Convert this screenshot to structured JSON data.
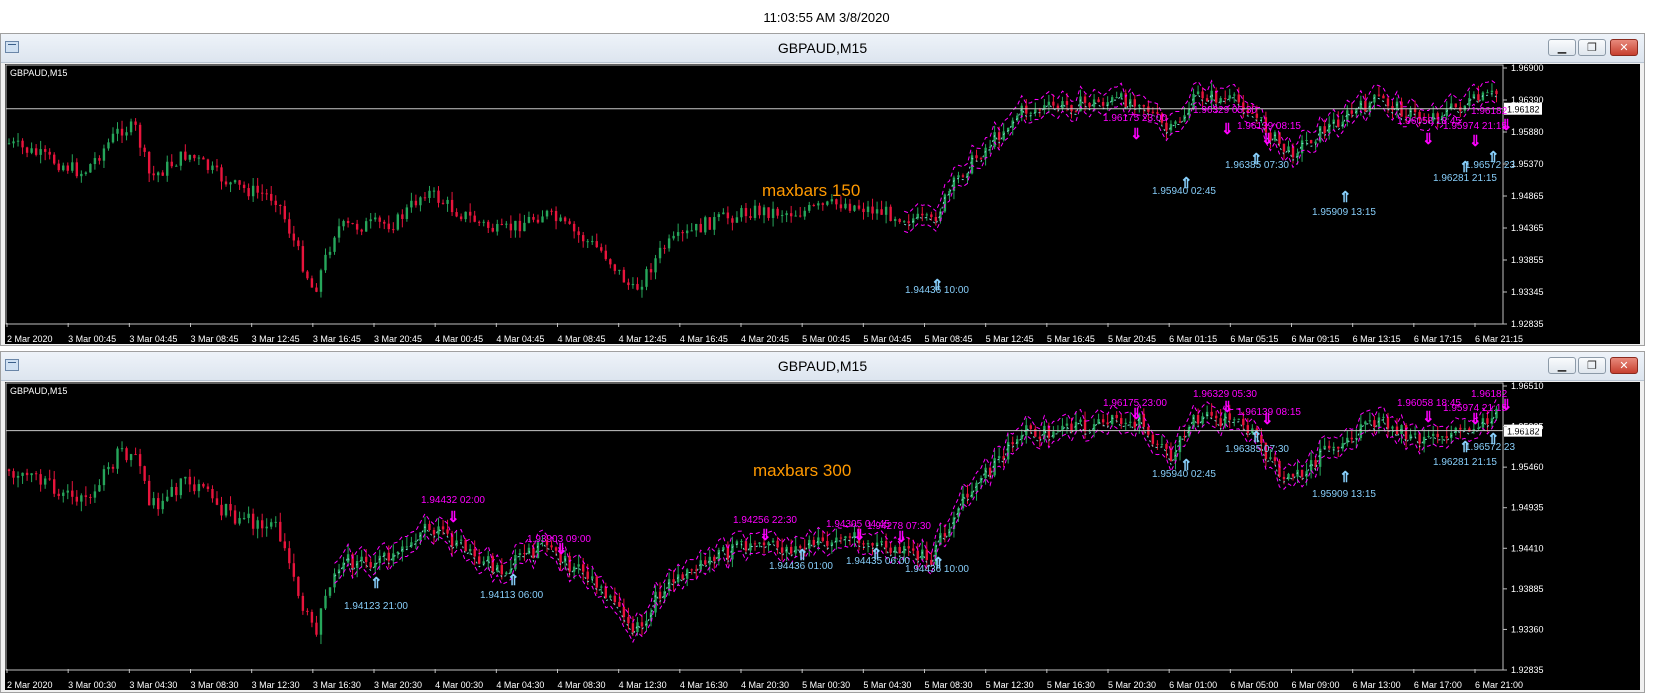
{
  "timestamp": "11:03:55 AM 3/8/2020",
  "windows": [
    {
      "title": "GBPAUD,M15",
      "symbol_label": "GBPAUD,M15",
      "annotation": "maxbars 150",
      "current_price": "1.96182",
      "price_axis": [
        "1.96900",
        "1.96390",
        "1.95880",
        "1.95370",
        "1.94865",
        "1.94365",
        "1.93855",
        "1.93345",
        "1.92835"
      ],
      "time_axis": [
        "2 Mar 2020",
        "3 Mar 00:45",
        "3 Mar 04:45",
        "3 Mar 08:45",
        "3 Mar 12:45",
        "3 Mar 16:45",
        "3 Mar 20:45",
        "4 Mar 00:45",
        "4 Mar 04:45",
        "4 Mar 08:45",
        "4 Mar 12:45",
        "4 Mar 16:45",
        "4 Mar 20:45",
        "5 Mar 00:45",
        "5 Mar 04:45",
        "5 Mar 08:45",
        "5 Mar 12:45",
        "5 Mar 16:45",
        "5 Mar 20:45",
        "6 Mar 01:15",
        "6 Mar 05:15",
        "6 Mar 09:15",
        "6 Mar 13:15",
        "6 Mar 17:15",
        "6 Mar 21:15"
      ],
      "high_labels": [
        "1.96175 23:00",
        "1.96329 05:30",
        "1.96139 08:15",
        "1.96058 18:45",
        "1.95974 21:15",
        "1.96182"
      ],
      "low_labels": [
        "1.94436 10:00",
        "1.95940 02:45",
        "1.96385 07:30",
        "1.95909 13:15",
        "1.96281 21:15",
        "1.96572 23"
      ]
    },
    {
      "title": "GBPAUD,M15",
      "symbol_label": "GBPAUD,M15",
      "annotation": "maxbars 300",
      "current_price": "1.96182",
      "price_axis": [
        "1.96510",
        "1.95985",
        "1.95460",
        "1.94935",
        "1.94410",
        "1.93885",
        "1.93360",
        "1.92835"
      ],
      "time_axis": [
        "2 Mar 2020",
        "3 Mar 00:30",
        "3 Mar 04:30",
        "3 Mar 08:30",
        "3 Mar 12:30",
        "3 Mar 16:30",
        "3 Mar 20:30",
        "4 Mar 00:30",
        "4 Mar 04:30",
        "4 Mar 08:30",
        "4 Mar 12:30",
        "4 Mar 16:30",
        "4 Mar 20:30",
        "5 Mar 00:30",
        "5 Mar 04:30",
        "5 Mar 08:30",
        "5 Mar 12:30",
        "5 Mar 16:30",
        "5 Mar 20:30",
        "6 Mar 01:00",
        "6 Mar 05:00",
        "6 Mar 09:00",
        "6 Mar 13:00",
        "6 Mar 17:00",
        "6 Mar 21:00"
      ],
      "high_labels": [
        "1.94432 02:00",
        "1.93903 09:00",
        "1.94256 22:30",
        "1.94305 04:45",
        "1.94278 07:30",
        "1.96175 23:00",
        "1.96329 05:30",
        "1.96139 08:15",
        "1.96058 18:45",
        "1.95974 21:15",
        "1.96182"
      ],
      "low_labels": [
        "1.94123 21:00",
        "1.94113 06:00",
        "1.94436 01:00",
        "1.94435 06:00",
        "1.94436 10:00",
        "1.95940 02:45",
        "1.96385 07:30",
        "1.95909 13:15",
        "1.96281 21:15",
        "1.96572 23"
      ]
    }
  ],
  "colors": {
    "bull_candle": "#26a65b",
    "bear_candle": "#e8143c",
    "band": "#ff00ff",
    "signal_high": "#ff00ff",
    "signal_low": "#87cefa",
    "annotation": "#ff9900",
    "axis_text": "#ffffff",
    "background": "#000000"
  },
  "icons": {
    "minimize": "minimize-icon",
    "restore": "restore-icon",
    "close": "close-icon",
    "chart": "chart-window-icon"
  }
}
